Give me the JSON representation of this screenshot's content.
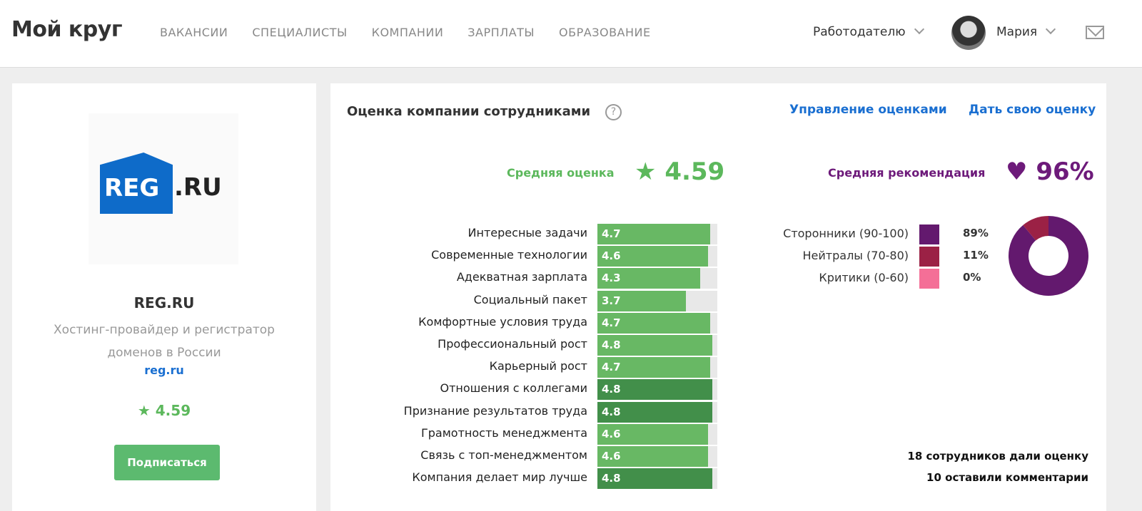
{
  "header": {
    "logo": "Мой круг",
    "nav": [
      "ВАКАНСИИ",
      "СПЕЦИАЛИСТЫ",
      "КОМПАНИИ",
      "ЗАРПЛАТЫ",
      "ОБРАЗОВАНИЕ"
    ],
    "employer": "Работодателю",
    "user": "Мария"
  },
  "company": {
    "logo_text": "REG.RU",
    "name": "REG.RU",
    "description": "Хостинг-провайдер и регистратор доменов в России",
    "url": "reg.ru",
    "rating": "4.59",
    "subscribe": "Подписаться"
  },
  "ratings": {
    "title": "Оценка компании сотрудниками",
    "help": "?",
    "manage": "Управление оценками",
    "give": "Дать свою оценку",
    "avg_label": "Средняя оценка",
    "avg_value": "4.59",
    "rec_label": "Средняя рекомендация",
    "rec_value": "96%",
    "items": [
      {
        "label": "Интересные задачи",
        "value": 4.7,
        "highlight": false
      },
      {
        "label": "Современные технологии",
        "value": 4.6,
        "highlight": false
      },
      {
        "label": "Адекватная зарплата",
        "value": 4.3,
        "highlight": false
      },
      {
        "label": "Социальный пакет",
        "value": 3.7,
        "highlight": false
      },
      {
        "label": "Комфортные условия труда",
        "value": 4.7,
        "highlight": false
      },
      {
        "label": "Профессиональный рост",
        "value": 4.8,
        "highlight": false
      },
      {
        "label": "Карьерный рост",
        "value": 4.7,
        "highlight": false
      },
      {
        "label": "Отношения с коллегами",
        "value": 4.8,
        "highlight": true
      },
      {
        "label": "Признание результатов труда",
        "value": 4.8,
        "highlight": true
      },
      {
        "label": "Грамотность менеджмента",
        "value": 4.6,
        "highlight": false
      },
      {
        "label": "Связь с топ-менеджментом",
        "value": 4.6,
        "highlight": false
      },
      {
        "label": "Компания делает мир лучше",
        "value": 4.8,
        "highlight": true
      }
    ],
    "max": 5,
    "recommend": [
      {
        "label": "Сторонники (90-100)",
        "percent": 89,
        "display": "89%",
        "color": "#63196e"
      },
      {
        "label": "Нейтралы (70-80)",
        "percent": 11,
        "display": "11%",
        "color": "#9b2145"
      },
      {
        "label": "Критики (0-60)",
        "percent": 0,
        "display": "0%",
        "color": "#f46f97"
      }
    ],
    "footer1": "18 сотрудников дали оценку",
    "footer2": "10 оставили комментарии"
  }
}
